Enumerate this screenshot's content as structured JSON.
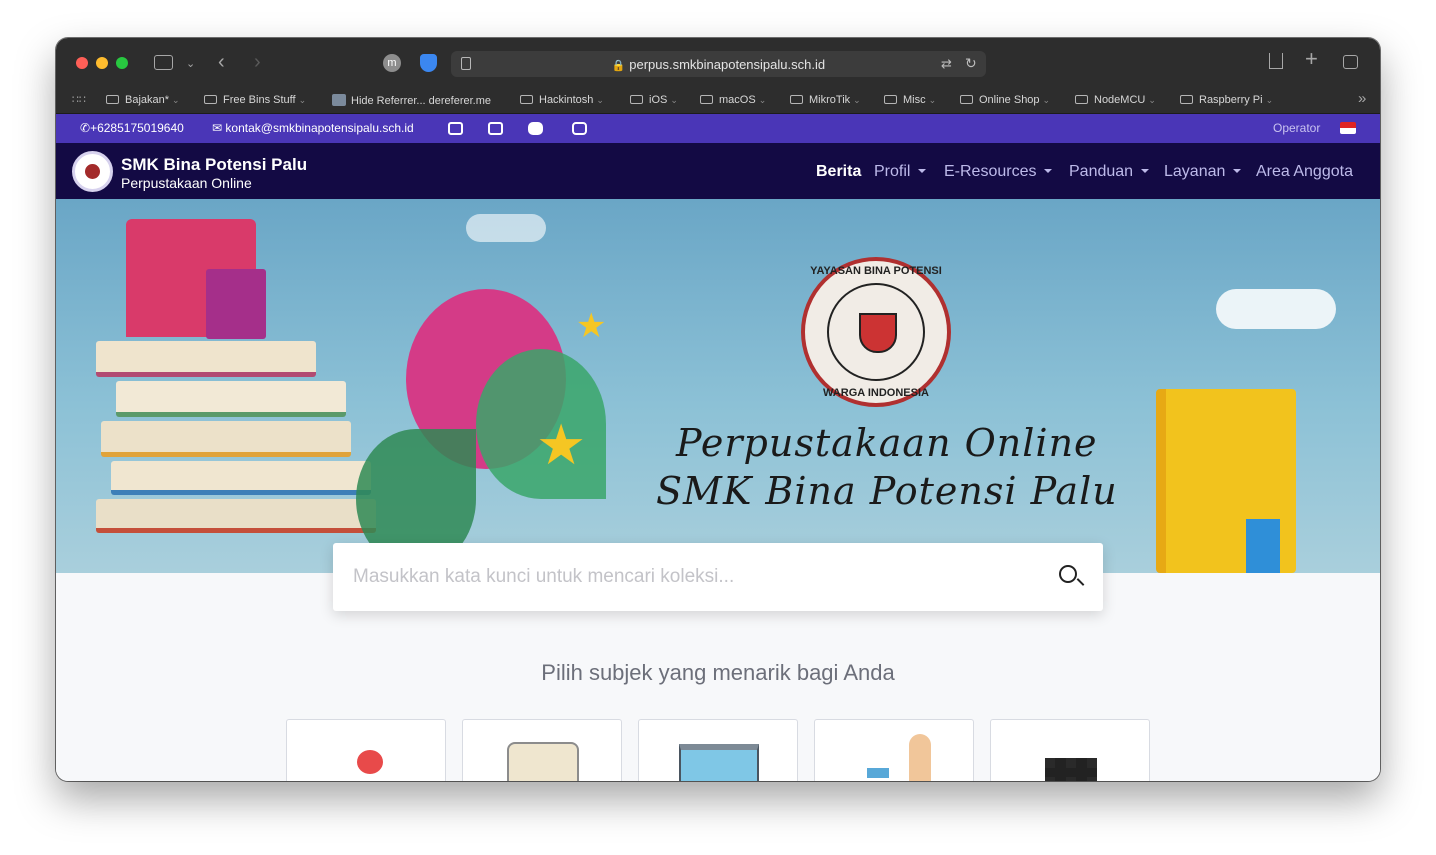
{
  "browser": {
    "url": "perpus.smkbinapotensipalu.sch.id",
    "profile_initial": "m",
    "bookmarks": [
      {
        "label": "Bajakan*",
        "folder": true
      },
      {
        "label": "Free Bins Stuff",
        "folder": true
      },
      {
        "label": "Hide Referrer... dereferer.me",
        "folder": false
      },
      {
        "label": "Hackintosh",
        "folder": true
      },
      {
        "label": "iOS",
        "folder": true
      },
      {
        "label": "macOS",
        "folder": true
      },
      {
        "label": "MikroTik",
        "folder": true
      },
      {
        "label": "Misc",
        "folder": true
      },
      {
        "label": "Online Shop",
        "folder": true
      },
      {
        "label": "NodeMCU",
        "folder": true
      },
      {
        "label": "Raspberry Pi",
        "folder": true
      }
    ]
  },
  "topbar": {
    "phone": "+6285175019640",
    "email": "kontak@smkbinapotensipalu.sch.id",
    "operator_label": "Operator",
    "social_icons": [
      "facebook-icon",
      "twitter-icon",
      "youtube-icon",
      "instagram-icon"
    ]
  },
  "navbar": {
    "brand_title": "SMK Bina Potensi Palu",
    "brand_subtitle": "Perpustakaan Online",
    "items": [
      {
        "label": "Berita",
        "dropdown": false,
        "active": true
      },
      {
        "label": "Profil",
        "dropdown": true
      },
      {
        "label": "E-Resources",
        "dropdown": true
      },
      {
        "label": "Panduan",
        "dropdown": true
      },
      {
        "label": "Layanan",
        "dropdown": true
      },
      {
        "label": "Area Anggota",
        "dropdown": false
      }
    ]
  },
  "hero": {
    "line1": "Perpustakaan Online",
    "line2": "SMK Bina Potensi Palu",
    "seal_top": "YAYASAN BINA POTENSI",
    "seal_bottom": "WARGA INDONESIA"
  },
  "search": {
    "placeholder": "Masukkan kata kunci untuk mencari koleksi..."
  },
  "subjects": {
    "heading": "Pilih subjek yang menarik bagi Anda",
    "cards": [
      "apple-icon",
      "scroll-icon",
      "blackboard-icon",
      "pencil-icon",
      "grid-icon"
    ]
  },
  "colors": {
    "topbar": "#4a36b7",
    "navbar": "#130a44",
    "browser_chrome": "#2d2d2d"
  }
}
